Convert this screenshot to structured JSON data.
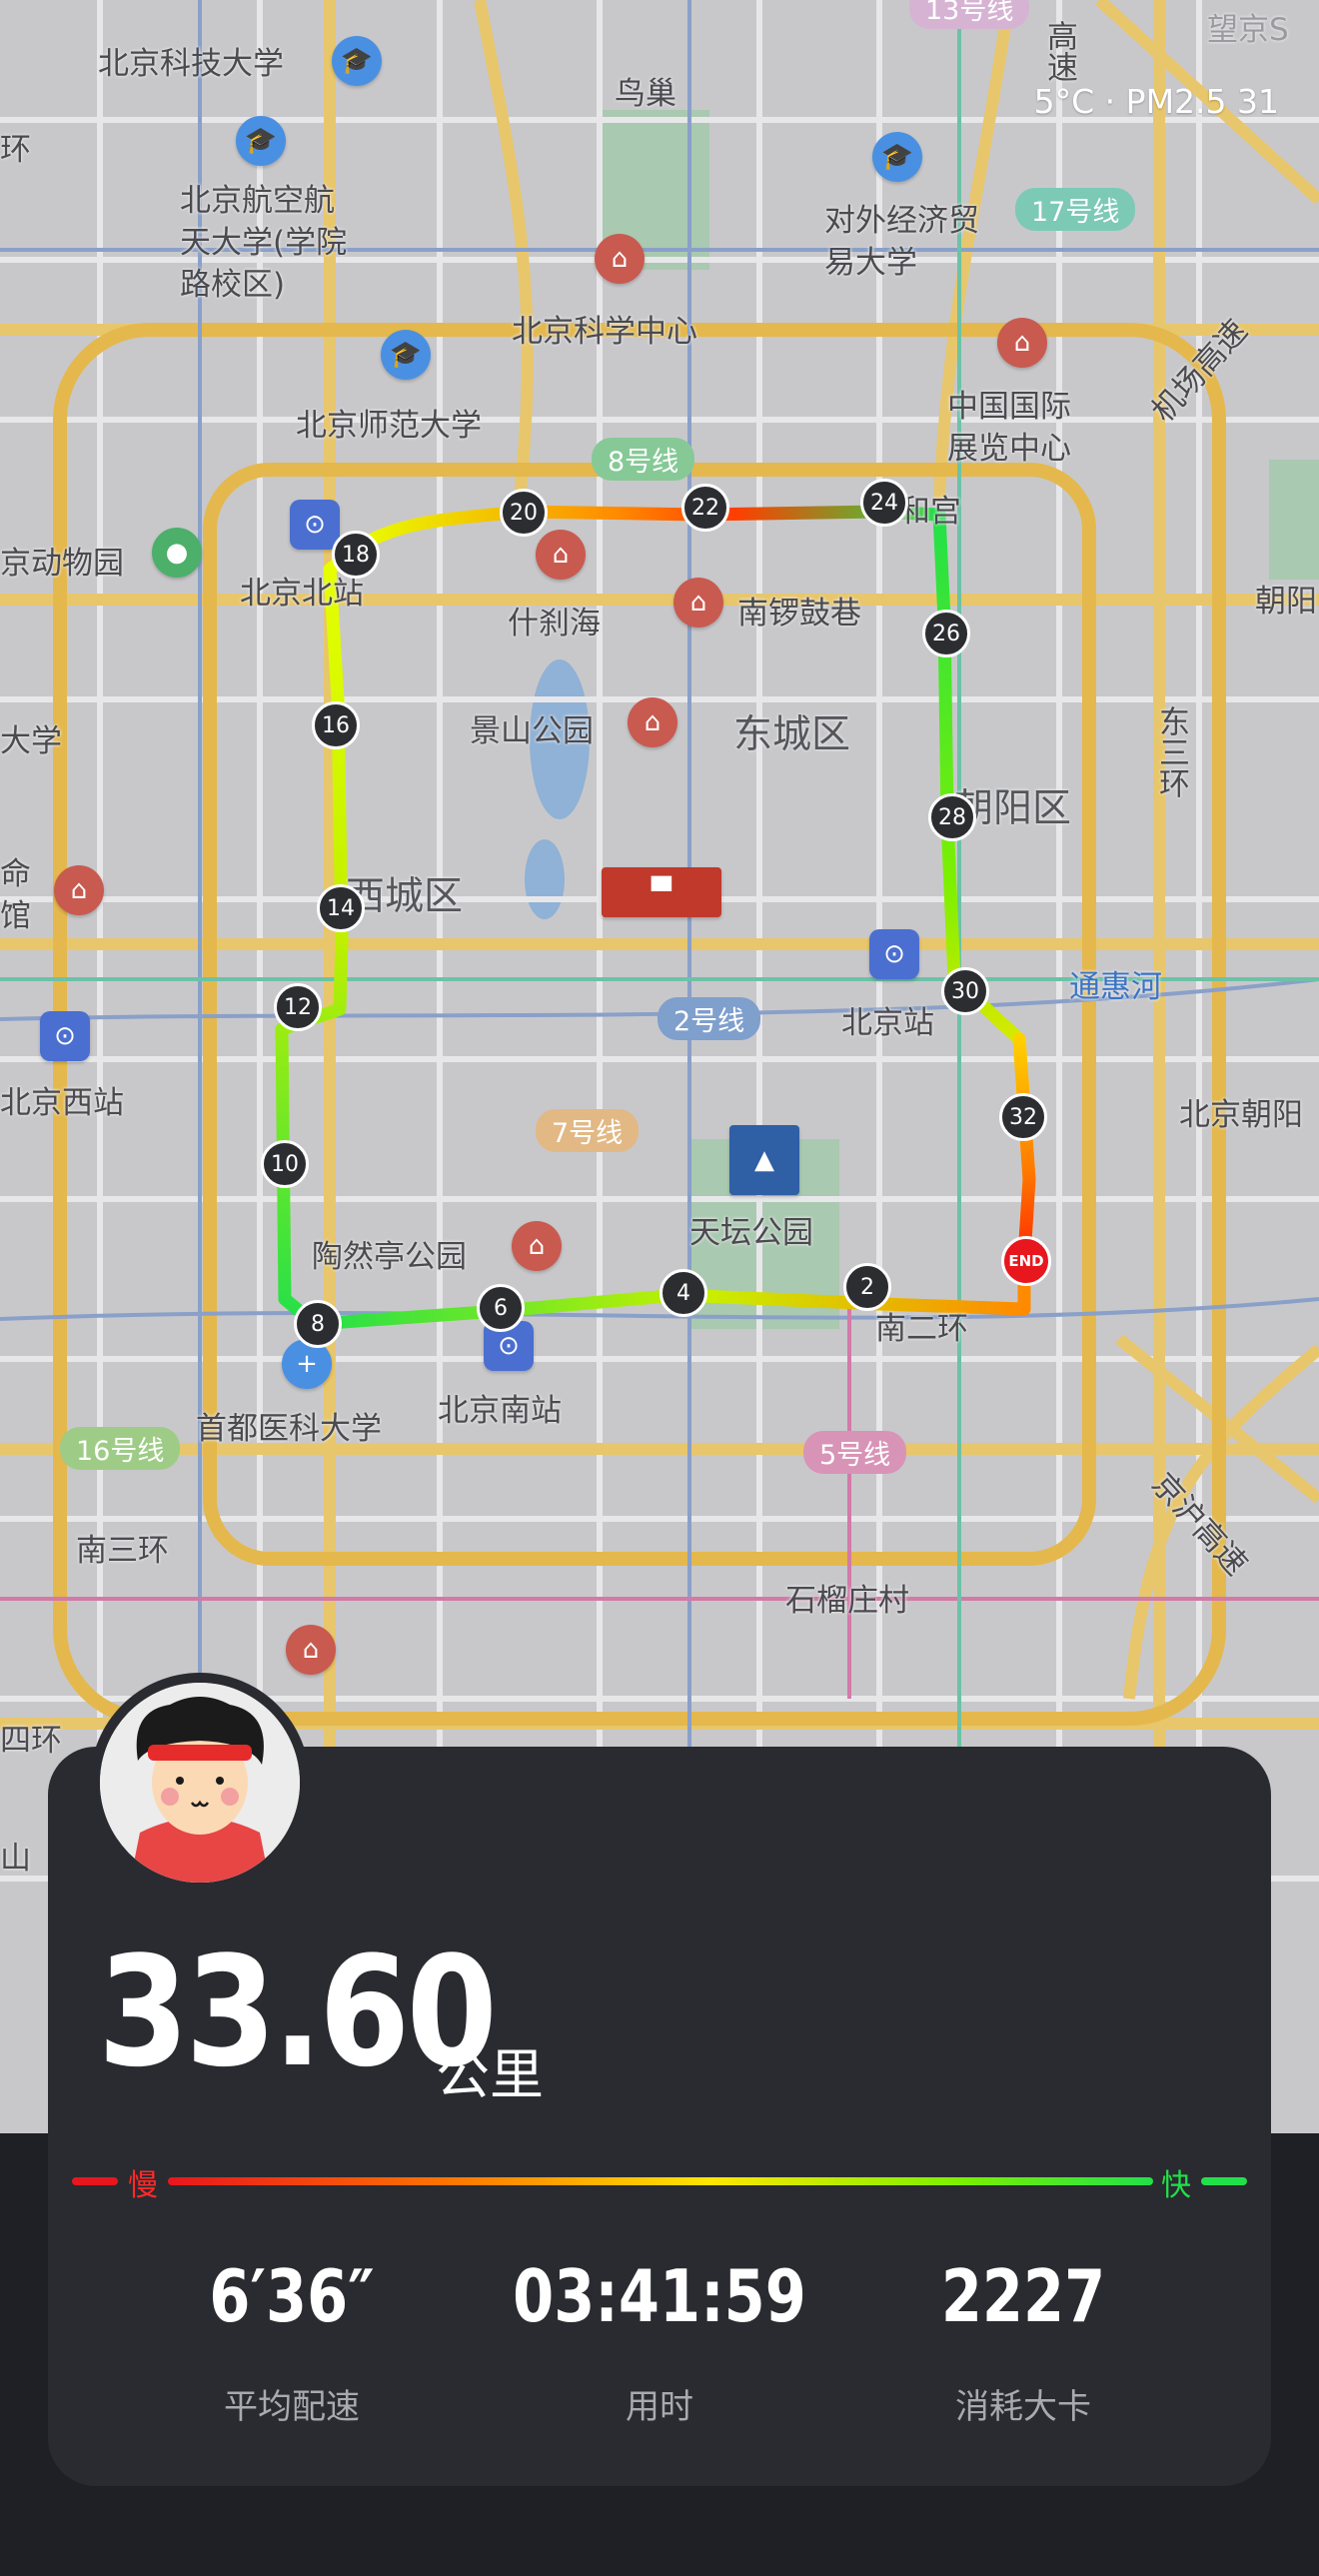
{
  "weather": {
    "text": "5°C · PM2.5 31"
  },
  "map": {
    "labels": {
      "bjkj": "北京科技大学",
      "niaochao": "鸟巢",
      "wangjing": "望京S",
      "huan_left": "环",
      "bhangkong": "北京航空航天大学(学院路校区)",
      "duiwai": "对外经济贸易大学",
      "line17": "17号线",
      "line13": "13号线",
      "jichang": "机场高速",
      "kexue": "北京科学中心",
      "gaosu_top": "高速",
      "beishi": "北京师范大学",
      "guoji": "中国国际展览中心",
      "line8": "8号线",
      "dongwu": "京动物园",
      "yonghegong": "和宫",
      "chaoyang_r": "朝阳",
      "beijingzhan_n": "北京北站",
      "shichahai": "什刹海",
      "nanluo": "南锣鼓巷",
      "daxue": "大学",
      "jingshan": "景山公园",
      "dongcheng": "东城区",
      "dongsanhuan": "东三环",
      "chaoyangqu": "朝阳区",
      "geming": "命馆",
      "xicheng": "西城区",
      "line2": "2号线",
      "beijingzhan": "北京站",
      "tonghui": "通惠河",
      "beixizhan": "北京西站",
      "line7": "7号线",
      "bjchaoyang": "北京朝阳",
      "taoranting": "陶然亭公园",
      "tiantan": "天坛公园",
      "nanerhuan": "南二环",
      "shoudu": "首都医科大学",
      "nanzhan": "北京南站",
      "line16": "16号线",
      "line5": "5号线",
      "jinghu": "京沪高速",
      "nansanhuan": "南三环",
      "shiliu": "石榴庄村",
      "sihuan": "四环",
      "shan": "山"
    },
    "km_markers": [
      "2",
      "4",
      "6",
      "8",
      "10",
      "12",
      "14",
      "16",
      "18",
      "20",
      "22",
      "24",
      "26",
      "28",
      "30",
      "32"
    ],
    "end_label": "END"
  },
  "summary": {
    "distance": "33.60",
    "distance_unit": "公里",
    "pace_slow": "慢",
    "pace_fast": "快",
    "stats": [
      {
        "value": "6′36″",
        "label": "平均配速"
      },
      {
        "value": "03:41:59",
        "label": "用时"
      },
      {
        "value": "2227",
        "label": "消耗大卡"
      }
    ]
  },
  "colors": {
    "slow": "#e8161d",
    "medium": "#ffe600",
    "fast": "#22e04a",
    "card": "#2a2b30"
  }
}
